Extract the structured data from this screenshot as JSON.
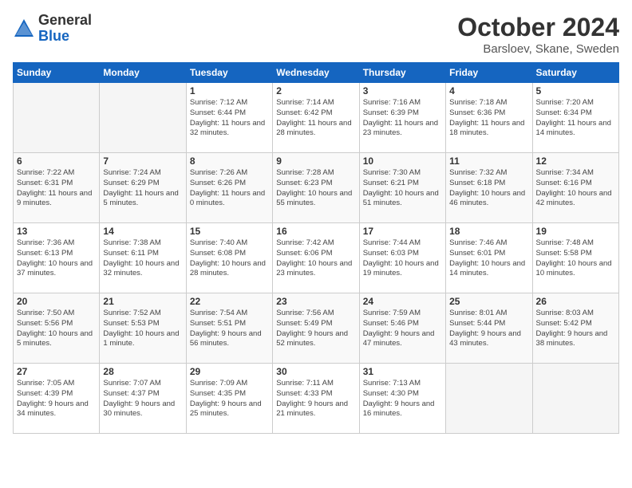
{
  "header": {
    "logo_general": "General",
    "logo_blue": "Blue",
    "title": "October 2024",
    "location": "Barsloev, Skane, Sweden"
  },
  "weekdays": [
    "Sunday",
    "Monday",
    "Tuesday",
    "Wednesday",
    "Thursday",
    "Friday",
    "Saturday"
  ],
  "weeks": [
    [
      {
        "day": "",
        "empty": true
      },
      {
        "day": "",
        "empty": true
      },
      {
        "day": "1",
        "sunrise": "7:12 AM",
        "sunset": "6:44 PM",
        "daylight": "11 hours and 32 minutes."
      },
      {
        "day": "2",
        "sunrise": "7:14 AM",
        "sunset": "6:42 PM",
        "daylight": "11 hours and 28 minutes."
      },
      {
        "day": "3",
        "sunrise": "7:16 AM",
        "sunset": "6:39 PM",
        "daylight": "11 hours and 23 minutes."
      },
      {
        "day": "4",
        "sunrise": "7:18 AM",
        "sunset": "6:36 PM",
        "daylight": "11 hours and 18 minutes."
      },
      {
        "day": "5",
        "sunrise": "7:20 AM",
        "sunset": "6:34 PM",
        "daylight": "11 hours and 14 minutes."
      }
    ],
    [
      {
        "day": "6",
        "sunrise": "7:22 AM",
        "sunset": "6:31 PM",
        "daylight": "11 hours and 9 minutes."
      },
      {
        "day": "7",
        "sunrise": "7:24 AM",
        "sunset": "6:29 PM",
        "daylight": "11 hours and 5 minutes."
      },
      {
        "day": "8",
        "sunrise": "7:26 AM",
        "sunset": "6:26 PM",
        "daylight": "11 hours and 0 minutes."
      },
      {
        "day": "9",
        "sunrise": "7:28 AM",
        "sunset": "6:23 PM",
        "daylight": "10 hours and 55 minutes."
      },
      {
        "day": "10",
        "sunrise": "7:30 AM",
        "sunset": "6:21 PM",
        "daylight": "10 hours and 51 minutes."
      },
      {
        "day": "11",
        "sunrise": "7:32 AM",
        "sunset": "6:18 PM",
        "daylight": "10 hours and 46 minutes."
      },
      {
        "day": "12",
        "sunrise": "7:34 AM",
        "sunset": "6:16 PM",
        "daylight": "10 hours and 42 minutes."
      }
    ],
    [
      {
        "day": "13",
        "sunrise": "7:36 AM",
        "sunset": "6:13 PM",
        "daylight": "10 hours and 37 minutes."
      },
      {
        "day": "14",
        "sunrise": "7:38 AM",
        "sunset": "6:11 PM",
        "daylight": "10 hours and 32 minutes."
      },
      {
        "day": "15",
        "sunrise": "7:40 AM",
        "sunset": "6:08 PM",
        "daylight": "10 hours and 28 minutes."
      },
      {
        "day": "16",
        "sunrise": "7:42 AM",
        "sunset": "6:06 PM",
        "daylight": "10 hours and 23 minutes."
      },
      {
        "day": "17",
        "sunrise": "7:44 AM",
        "sunset": "6:03 PM",
        "daylight": "10 hours and 19 minutes."
      },
      {
        "day": "18",
        "sunrise": "7:46 AM",
        "sunset": "6:01 PM",
        "daylight": "10 hours and 14 minutes."
      },
      {
        "day": "19",
        "sunrise": "7:48 AM",
        "sunset": "5:58 PM",
        "daylight": "10 hours and 10 minutes."
      }
    ],
    [
      {
        "day": "20",
        "sunrise": "7:50 AM",
        "sunset": "5:56 PM",
        "daylight": "10 hours and 5 minutes."
      },
      {
        "day": "21",
        "sunrise": "7:52 AM",
        "sunset": "5:53 PM",
        "daylight": "10 hours and 1 minute."
      },
      {
        "day": "22",
        "sunrise": "7:54 AM",
        "sunset": "5:51 PM",
        "daylight": "9 hours and 56 minutes."
      },
      {
        "day": "23",
        "sunrise": "7:56 AM",
        "sunset": "5:49 PM",
        "daylight": "9 hours and 52 minutes."
      },
      {
        "day": "24",
        "sunrise": "7:59 AM",
        "sunset": "5:46 PM",
        "daylight": "9 hours and 47 minutes."
      },
      {
        "day": "25",
        "sunrise": "8:01 AM",
        "sunset": "5:44 PM",
        "daylight": "9 hours and 43 minutes."
      },
      {
        "day": "26",
        "sunrise": "8:03 AM",
        "sunset": "5:42 PM",
        "daylight": "9 hours and 38 minutes."
      }
    ],
    [
      {
        "day": "27",
        "sunrise": "7:05 AM",
        "sunset": "4:39 PM",
        "daylight": "9 hours and 34 minutes."
      },
      {
        "day": "28",
        "sunrise": "7:07 AM",
        "sunset": "4:37 PM",
        "daylight": "9 hours and 30 minutes."
      },
      {
        "day": "29",
        "sunrise": "7:09 AM",
        "sunset": "4:35 PM",
        "daylight": "9 hours and 25 minutes."
      },
      {
        "day": "30",
        "sunrise": "7:11 AM",
        "sunset": "4:33 PM",
        "daylight": "9 hours and 21 minutes."
      },
      {
        "day": "31",
        "sunrise": "7:13 AM",
        "sunset": "4:30 PM",
        "daylight": "9 hours and 16 minutes."
      },
      {
        "day": "",
        "empty": true
      },
      {
        "day": "",
        "empty": true
      }
    ]
  ],
  "labels": {
    "sunrise": "Sunrise:",
    "sunset": "Sunset:",
    "daylight": "Daylight:"
  }
}
